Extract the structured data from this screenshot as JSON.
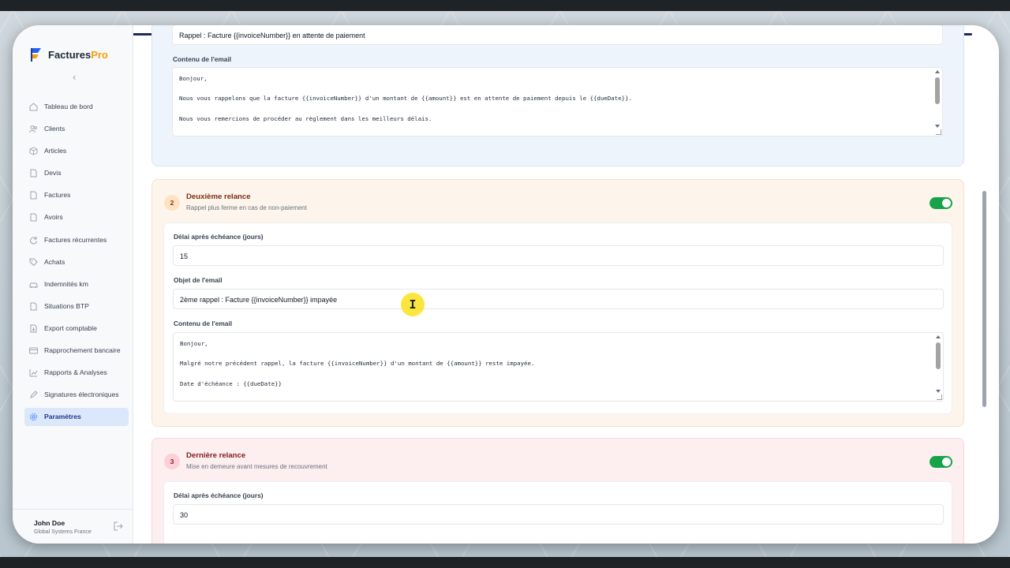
{
  "app": {
    "name_main": "Factures",
    "name_accent": "Pro"
  },
  "sidebar": {
    "items": [
      {
        "label": "Tableau de bord",
        "icon": "home-icon"
      },
      {
        "label": "Clients",
        "icon": "users-icon"
      },
      {
        "label": "Articles",
        "icon": "box-icon"
      },
      {
        "label": "Devis",
        "icon": "file-icon"
      },
      {
        "label": "Factures",
        "icon": "file-icon"
      },
      {
        "label": "Avoirs",
        "icon": "file-icon"
      },
      {
        "label": "Factures récurrentes",
        "icon": "refresh-icon"
      },
      {
        "label": "Achats",
        "icon": "tag-icon"
      },
      {
        "label": "Indemnités km",
        "icon": "car-icon"
      },
      {
        "label": "Situations BTP",
        "icon": "file-icon"
      },
      {
        "label": "Export comptable",
        "icon": "export-icon"
      },
      {
        "label": "Rapprochement bancaire",
        "icon": "card-icon"
      },
      {
        "label": "Rapports & Analyses",
        "icon": "chart-icon"
      },
      {
        "label": "Signatures électroniques",
        "icon": "pen-icon"
      },
      {
        "label": "Paramètres",
        "icon": "gear-icon",
        "active": true
      }
    ],
    "user": {
      "name": "John Doe",
      "company": "Global Systems France"
    }
  },
  "reminders": {
    "first": {
      "subject_value": "Rappel : Facture {{invoiceNumber}} en attente de paiement",
      "content_label": "Contenu de l'email",
      "content_value": "Bonjour,\n\nNous vous rappelons que la facture {{invoiceNumber}} d'un montant de {{amount}} est en attente de paiement depuis le {{dueDate}}.\n\nNous vous remercions de procéder au règlement dans les meilleurs délais.\n\nCordialement"
    },
    "second": {
      "number": "2",
      "title": "Deuxième relance",
      "subtitle": "Rappel plus ferme en cas de non-paiement",
      "enabled": true,
      "delay_label": "Délai après échéance (jours)",
      "delay_value": "15",
      "subject_label": "Objet de l'email",
      "subject_value": "2ème rappel : Facture {{invoiceNumber}} impayée",
      "content_label": "Contenu de l'email",
      "content_value": "Bonjour,\n\nMalgré notre précédent rappel, la facture {{invoiceNumber}} d'un montant de {{amount}} reste impayée.\n\nDate d'échéance : {{dueDate}}\n\nMerci de régulariser votre situation rapidement."
    },
    "third": {
      "number": "3",
      "title": "Dernière relance",
      "subtitle": "Mise en demeure avant mesures de recouvrement",
      "enabled": true,
      "delay_label": "Délai après échéance (jours)",
      "delay_value": "30"
    }
  },
  "colors": {
    "accent": "#3b82f6",
    "toggle_on": "#16a34a",
    "brand_accent": "#f59e0b"
  }
}
